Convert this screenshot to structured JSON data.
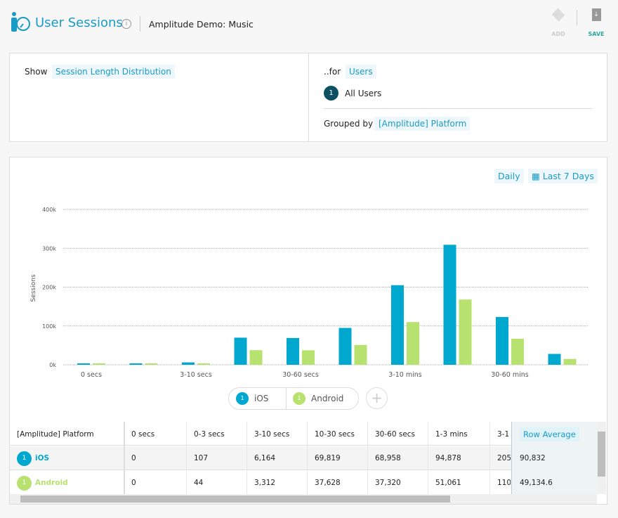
{
  "header": {
    "title": "User Sessions",
    "project": "Amplitude Demo: Music",
    "add_label": "ADD",
    "save_label": "SAVE",
    "info_glyph": "i"
  },
  "query": {
    "show_label": "Show",
    "show_value": "Session Length Distribution",
    "for_label": "..for",
    "for_value": "Users",
    "segment_number": "1",
    "segment_name": "All Users",
    "grouped_label": "Grouped by",
    "grouped_value": "[Amplitude] Platform"
  },
  "controls": {
    "interval": "Daily",
    "range": "Last 7 Days"
  },
  "colors": {
    "ios": "#00a7cf",
    "android": "#b8e26f",
    "accent": "#1a9bc7",
    "dark": "#0d4f63"
  },
  "chart_data": {
    "type": "bar",
    "ylabel": "Sessions",
    "ylim": [
      0,
      400000
    ],
    "yticks": [
      "0k",
      "100k",
      "200k",
      "300k",
      "400k"
    ],
    "grid": true,
    "categories": [
      "0 secs",
      "",
      "3-10 secs",
      "",
      "30-60 secs",
      "",
      "3-10 mins",
      "",
      "30-60 mins",
      ""
    ],
    "series": [
      {
        "name": "iOS",
        "values": [
          0,
          107,
          6164,
          69819,
          68958,
          94878,
          205000,
          309000,
          123000,
          28000
        ]
      },
      {
        "name": "Android",
        "values": [
          0,
          44,
          3312,
          37628,
          37320,
          51061,
          110000,
          168000,
          67000,
          15000
        ]
      }
    ]
  },
  "legend": [
    {
      "num": "1",
      "name": "iOS"
    },
    {
      "num": "1",
      "name": "Android"
    }
  ],
  "table": {
    "headers": [
      "[Amplitude] Platform",
      "0 secs",
      "0-3 secs",
      "3-10 secs",
      "10-30 secs",
      "30-60 secs",
      "1-3 mins",
      "3-1"
    ],
    "avg_header": "Row Average",
    "rows": [
      {
        "num": "1",
        "name": "iOS",
        "cells": [
          "0",
          "107",
          "6,164",
          "69,819",
          "68,958",
          "94,878",
          "205"
        ],
        "avg": "90,832"
      },
      {
        "num": "1",
        "name": "Android",
        "cells": [
          "0",
          "44",
          "3,312",
          "37,628",
          "37,320",
          "51,061",
          "110"
        ],
        "avg": "49,134.6"
      }
    ]
  }
}
